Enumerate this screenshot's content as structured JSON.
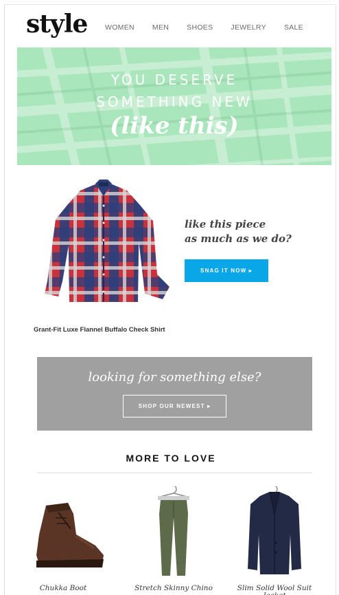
{
  "header": {
    "logo": "style",
    "nav": [
      "WOMEN",
      "MEN",
      "SHOES",
      "JEWELRY",
      "SALE"
    ]
  },
  "hero": {
    "line1": "YOU DESERVE",
    "line2": "SOMETHING NEW",
    "line3": "(like this)",
    "bg_color": "#a9e6bb"
  },
  "feature": {
    "product_name": "Grant-Fit Luxe Flannel Buffalo Check Shirt",
    "tagline_1": "like this piece",
    "tagline_2": "as much as we do?",
    "cta_label": "SNAG IT NOW ▸",
    "cta_color": "#0aa7e8"
  },
  "promo": {
    "title": "looking for something else?",
    "cta_label": "SHOP OUR NEWEST ▸",
    "bg_color": "#a0a0a0"
  },
  "more": {
    "title": "MORE TO LOVE",
    "items": [
      {
        "name": "Chukka Boot",
        "icon": "boot-image"
      },
      {
        "name": "Stretch Skinny Chino",
        "icon": "chino-image"
      },
      {
        "name": "Slim Solid Wool Suit Jacket",
        "icon": "jacket-image"
      }
    ]
  }
}
